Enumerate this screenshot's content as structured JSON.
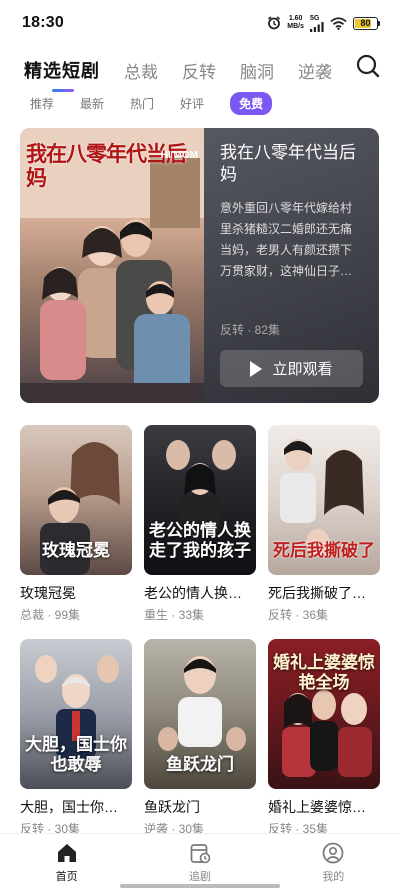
{
  "status_bar": {
    "time": "18:30",
    "net_speed_value": "1.60",
    "net_speed_unit": "MB/s",
    "network": "5G",
    "battery": "80",
    "battery_level": 0.8,
    "battery_color": "#e9c832"
  },
  "top_tabs": [
    {
      "label": "精选短剧",
      "active": true
    },
    {
      "label": "总裁",
      "active": false
    },
    {
      "label": "反转",
      "active": false
    },
    {
      "label": "脑洞",
      "active": false
    },
    {
      "label": "逆袭",
      "active": false
    }
  ],
  "sub_tabs": [
    {
      "label": "推荐"
    },
    {
      "label": "最新"
    },
    {
      "label": "热门"
    },
    {
      "label": "好评"
    },
    {
      "label": "免费",
      "highlighted": true
    }
  ],
  "featured": {
    "poster_title": "我在八零年代当后妈",
    "poster_subtitle": "HI MOM",
    "title": "我在八零年代当后妈",
    "description": "意外重回八零年代嫁给村里杀猪糙汉二婚郎还无痛当妈，老男人有颜还攒下万贯家财，这神仙日子…",
    "meta": "反转 · 82集",
    "play_label": "立即观看"
  },
  "dramas": [
    {
      "name": "玫瑰冠冕",
      "meta": "总裁 · 99集",
      "cover_text": "玫瑰冠冕"
    },
    {
      "name": "老公的情人换…",
      "meta": "重生 · 33集",
      "cover_text": "老公的情人换走了我的孩子"
    },
    {
      "name": "死后我撕破了…",
      "meta": "反转 · 36集",
      "cover_text": "死后我撕破了"
    },
    {
      "name": "大胆，国士你…",
      "meta": "反转 · 30集",
      "cover_text": "大胆，国士你也敢辱"
    },
    {
      "name": "鱼跃龙门",
      "meta": "逆袭 · 30集",
      "cover_text": "鱼跃龙门"
    },
    {
      "name": "婚礼上婆婆惊…",
      "meta": "反转 · 35集",
      "cover_text": "婚礼上婆婆惊艳全场"
    }
  ],
  "bottom_nav": [
    {
      "label": "首页",
      "icon": "home-icon",
      "active": true
    },
    {
      "label": "追剧",
      "icon": "history-icon",
      "active": false
    },
    {
      "label": "我的",
      "icon": "profile-icon",
      "active": false
    }
  ],
  "colors": {
    "accent": "#7b57f4",
    "tab_indicator_start": "#2a7df7",
    "tab_indicator_end": "#9b5cf5"
  }
}
